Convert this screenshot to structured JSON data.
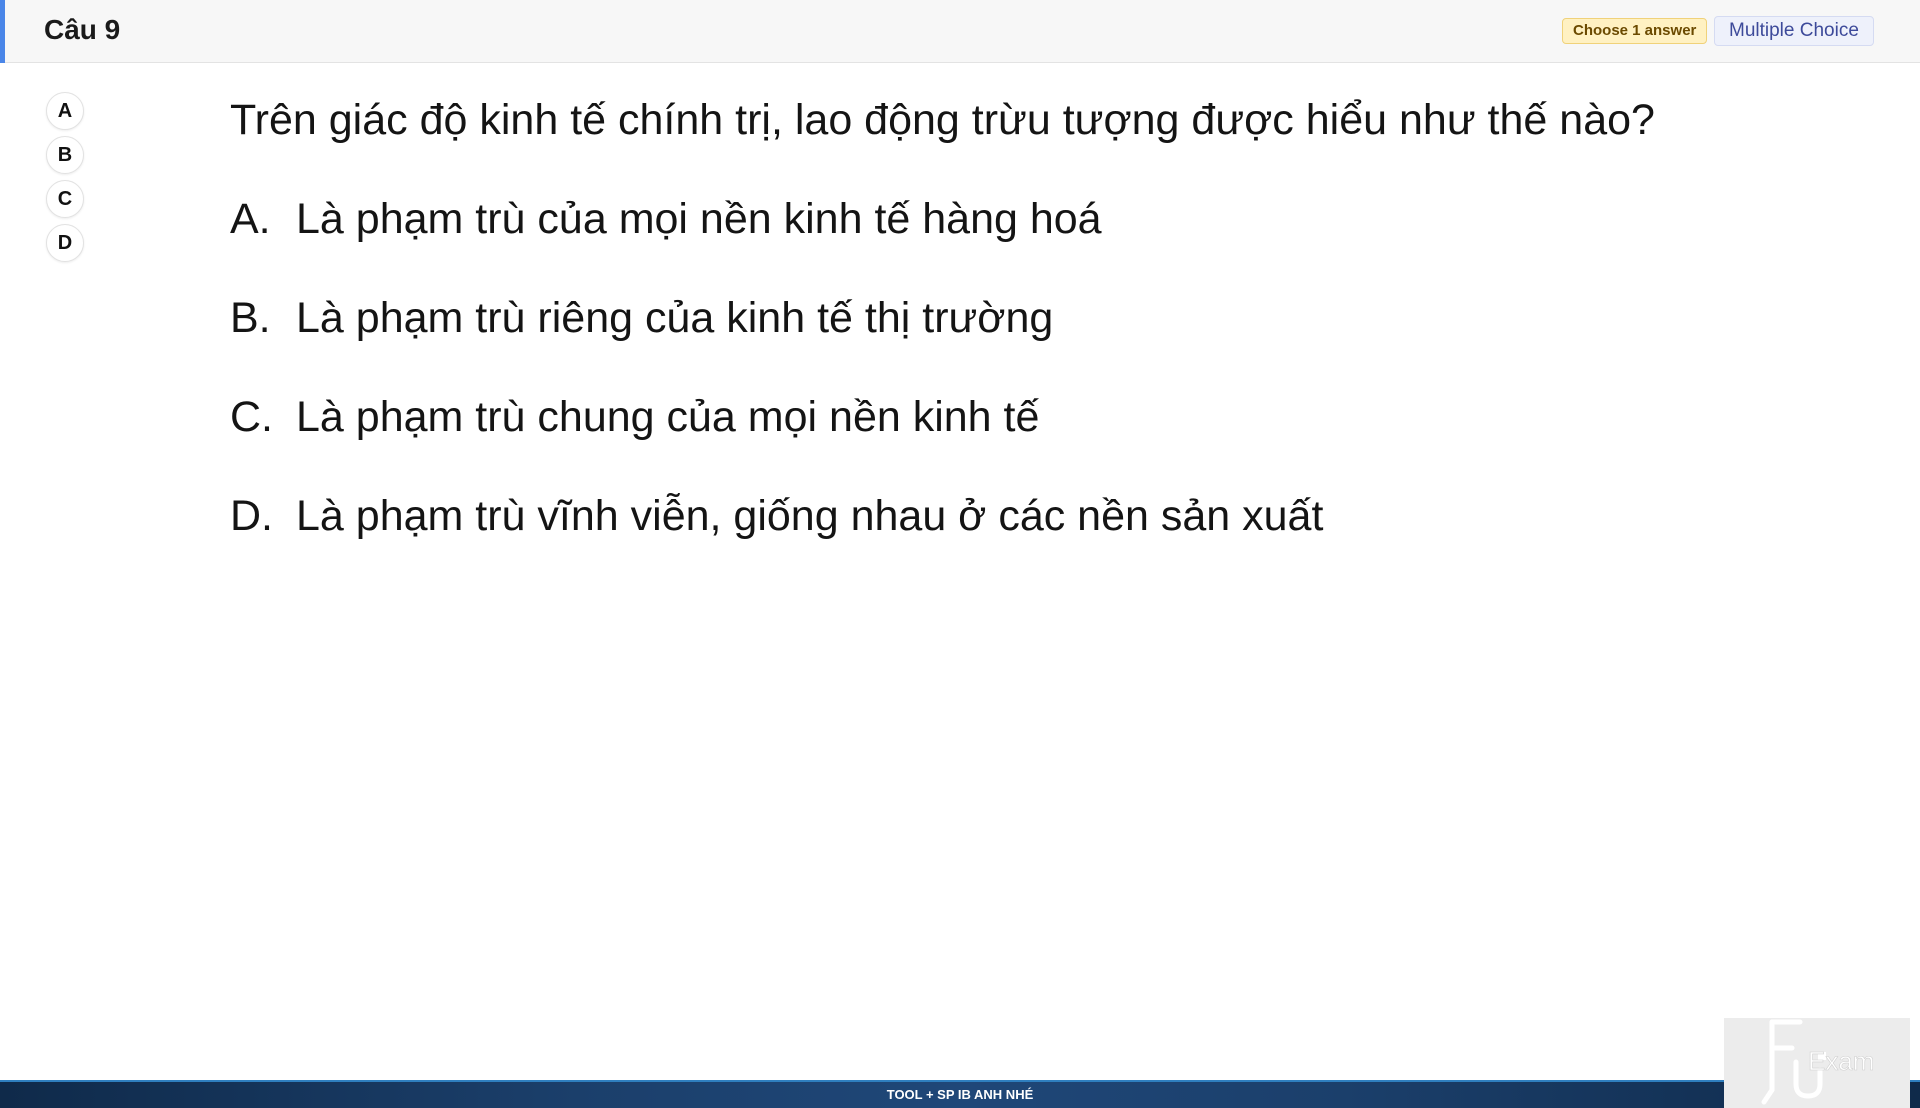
{
  "header": {
    "title": "Câu 9",
    "choose_badge": "Choose 1 answer",
    "type_badge": "Multiple Choice"
  },
  "answer_buttons": [
    "A",
    "B",
    "C",
    "D"
  ],
  "question": {
    "text": "Trên giác độ kinh tế chính trị, lao động trừu tượng được hiểu như thế nào?",
    "options": [
      {
        "letter": "A.",
        "text": "Là phạm trù của mọi nền kinh tế hàng hoá"
      },
      {
        "letter": "B.",
        "text": "Là phạm trù riêng của kinh tế thị trường"
      },
      {
        "letter": "C.",
        "text": "Là phạm trù chung của mọi nền kinh tế"
      },
      {
        "letter": "D.",
        "text": "Là phạm trù vĩnh viễn, giống nhau ở các nền sản xuất"
      }
    ]
  },
  "footer": {
    "text": "TOOL + SP IB ANH NHÉ"
  },
  "logo": {
    "text": "Exam"
  },
  "colors": {
    "accent": "#4a86e8",
    "footer_bg": "#1b3f6b"
  }
}
